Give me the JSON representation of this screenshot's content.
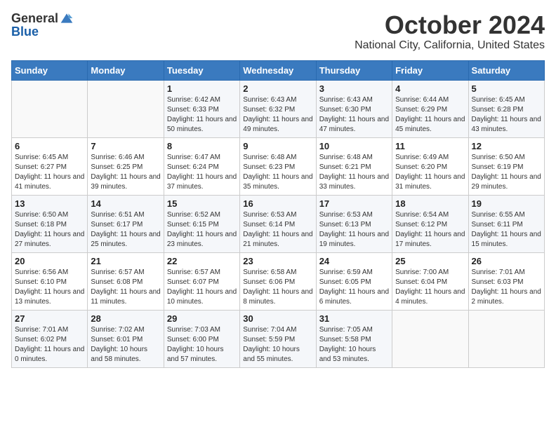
{
  "logo": {
    "general": "General",
    "blue": "Blue"
  },
  "title": {
    "month": "October 2024",
    "location": "National City, California, United States"
  },
  "weekdays": [
    "Sunday",
    "Monday",
    "Tuesday",
    "Wednesday",
    "Thursday",
    "Friday",
    "Saturday"
  ],
  "weeks": [
    [
      {
        "day": "",
        "sunrise": "",
        "sunset": "",
        "daylight": ""
      },
      {
        "day": "",
        "sunrise": "",
        "sunset": "",
        "daylight": ""
      },
      {
        "day": "1",
        "sunrise": "Sunrise: 6:42 AM",
        "sunset": "Sunset: 6:33 PM",
        "daylight": "Daylight: 11 hours and 50 minutes."
      },
      {
        "day": "2",
        "sunrise": "Sunrise: 6:43 AM",
        "sunset": "Sunset: 6:32 PM",
        "daylight": "Daylight: 11 hours and 49 minutes."
      },
      {
        "day": "3",
        "sunrise": "Sunrise: 6:43 AM",
        "sunset": "Sunset: 6:30 PM",
        "daylight": "Daylight: 11 hours and 47 minutes."
      },
      {
        "day": "4",
        "sunrise": "Sunrise: 6:44 AM",
        "sunset": "Sunset: 6:29 PM",
        "daylight": "Daylight: 11 hours and 45 minutes."
      },
      {
        "day": "5",
        "sunrise": "Sunrise: 6:45 AM",
        "sunset": "Sunset: 6:28 PM",
        "daylight": "Daylight: 11 hours and 43 minutes."
      }
    ],
    [
      {
        "day": "6",
        "sunrise": "Sunrise: 6:45 AM",
        "sunset": "Sunset: 6:27 PM",
        "daylight": "Daylight: 11 hours and 41 minutes."
      },
      {
        "day": "7",
        "sunrise": "Sunrise: 6:46 AM",
        "sunset": "Sunset: 6:25 PM",
        "daylight": "Daylight: 11 hours and 39 minutes."
      },
      {
        "day": "8",
        "sunrise": "Sunrise: 6:47 AM",
        "sunset": "Sunset: 6:24 PM",
        "daylight": "Daylight: 11 hours and 37 minutes."
      },
      {
        "day": "9",
        "sunrise": "Sunrise: 6:48 AM",
        "sunset": "Sunset: 6:23 PM",
        "daylight": "Daylight: 11 hours and 35 minutes."
      },
      {
        "day": "10",
        "sunrise": "Sunrise: 6:48 AM",
        "sunset": "Sunset: 6:21 PM",
        "daylight": "Daylight: 11 hours and 33 minutes."
      },
      {
        "day": "11",
        "sunrise": "Sunrise: 6:49 AM",
        "sunset": "Sunset: 6:20 PM",
        "daylight": "Daylight: 11 hours and 31 minutes."
      },
      {
        "day": "12",
        "sunrise": "Sunrise: 6:50 AM",
        "sunset": "Sunset: 6:19 PM",
        "daylight": "Daylight: 11 hours and 29 minutes."
      }
    ],
    [
      {
        "day": "13",
        "sunrise": "Sunrise: 6:50 AM",
        "sunset": "Sunset: 6:18 PM",
        "daylight": "Daylight: 11 hours and 27 minutes."
      },
      {
        "day": "14",
        "sunrise": "Sunrise: 6:51 AM",
        "sunset": "Sunset: 6:17 PM",
        "daylight": "Daylight: 11 hours and 25 minutes."
      },
      {
        "day": "15",
        "sunrise": "Sunrise: 6:52 AM",
        "sunset": "Sunset: 6:15 PM",
        "daylight": "Daylight: 11 hours and 23 minutes."
      },
      {
        "day": "16",
        "sunrise": "Sunrise: 6:53 AM",
        "sunset": "Sunset: 6:14 PM",
        "daylight": "Daylight: 11 hours and 21 minutes."
      },
      {
        "day": "17",
        "sunrise": "Sunrise: 6:53 AM",
        "sunset": "Sunset: 6:13 PM",
        "daylight": "Daylight: 11 hours and 19 minutes."
      },
      {
        "day": "18",
        "sunrise": "Sunrise: 6:54 AM",
        "sunset": "Sunset: 6:12 PM",
        "daylight": "Daylight: 11 hours and 17 minutes."
      },
      {
        "day": "19",
        "sunrise": "Sunrise: 6:55 AM",
        "sunset": "Sunset: 6:11 PM",
        "daylight": "Daylight: 11 hours and 15 minutes."
      }
    ],
    [
      {
        "day": "20",
        "sunrise": "Sunrise: 6:56 AM",
        "sunset": "Sunset: 6:10 PM",
        "daylight": "Daylight: 11 hours and 13 minutes."
      },
      {
        "day": "21",
        "sunrise": "Sunrise: 6:57 AM",
        "sunset": "Sunset: 6:08 PM",
        "daylight": "Daylight: 11 hours and 11 minutes."
      },
      {
        "day": "22",
        "sunrise": "Sunrise: 6:57 AM",
        "sunset": "Sunset: 6:07 PM",
        "daylight": "Daylight: 11 hours and 10 minutes."
      },
      {
        "day": "23",
        "sunrise": "Sunrise: 6:58 AM",
        "sunset": "Sunset: 6:06 PM",
        "daylight": "Daylight: 11 hours and 8 minutes."
      },
      {
        "day": "24",
        "sunrise": "Sunrise: 6:59 AM",
        "sunset": "Sunset: 6:05 PM",
        "daylight": "Daylight: 11 hours and 6 minutes."
      },
      {
        "day": "25",
        "sunrise": "Sunrise: 7:00 AM",
        "sunset": "Sunset: 6:04 PM",
        "daylight": "Daylight: 11 hours and 4 minutes."
      },
      {
        "day": "26",
        "sunrise": "Sunrise: 7:01 AM",
        "sunset": "Sunset: 6:03 PM",
        "daylight": "Daylight: 11 hours and 2 minutes."
      }
    ],
    [
      {
        "day": "27",
        "sunrise": "Sunrise: 7:01 AM",
        "sunset": "Sunset: 6:02 PM",
        "daylight": "Daylight: 11 hours and 0 minutes."
      },
      {
        "day": "28",
        "sunrise": "Sunrise: 7:02 AM",
        "sunset": "Sunset: 6:01 PM",
        "daylight": "Daylight: 10 hours and 58 minutes."
      },
      {
        "day": "29",
        "sunrise": "Sunrise: 7:03 AM",
        "sunset": "Sunset: 6:00 PM",
        "daylight": "Daylight: 10 hours and 57 minutes."
      },
      {
        "day": "30",
        "sunrise": "Sunrise: 7:04 AM",
        "sunset": "Sunset: 5:59 PM",
        "daylight": "Daylight: 10 hours and 55 minutes."
      },
      {
        "day": "31",
        "sunrise": "Sunrise: 7:05 AM",
        "sunset": "Sunset: 5:58 PM",
        "daylight": "Daylight: 10 hours and 53 minutes."
      },
      {
        "day": "",
        "sunrise": "",
        "sunset": "",
        "daylight": ""
      },
      {
        "day": "",
        "sunrise": "",
        "sunset": "",
        "daylight": ""
      }
    ]
  ]
}
